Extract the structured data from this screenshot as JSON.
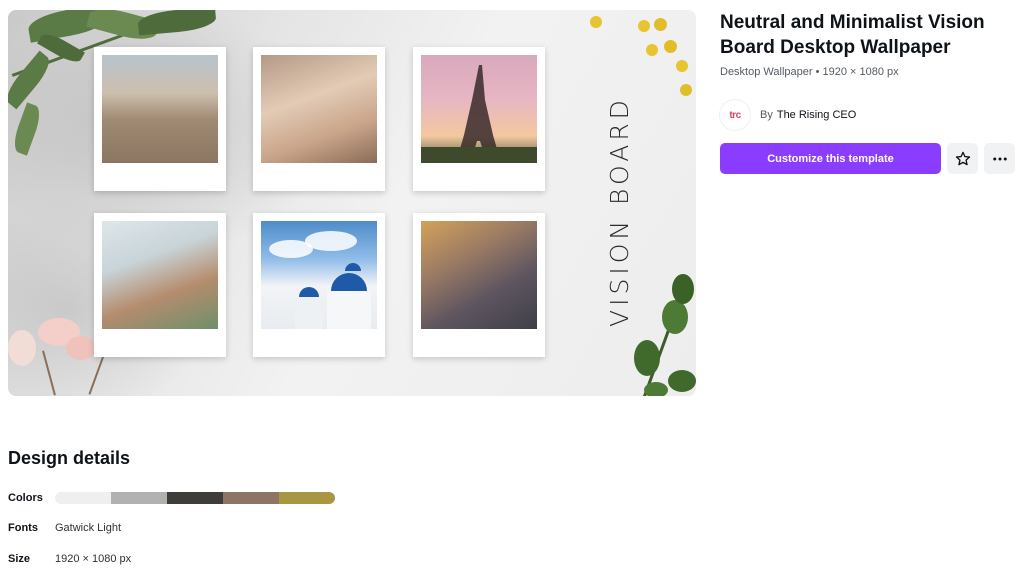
{
  "preview": {
    "vision_text": "VISION BOARD",
    "photos": [
      {
        "id": "fountain",
        "subject": "fountain-photo"
      },
      {
        "id": "family",
        "subject": "family-photo"
      },
      {
        "id": "paris",
        "subject": "eiffel-tower-photo"
      },
      {
        "id": "kitchen",
        "subject": "kitchen-photo"
      },
      {
        "id": "santorini",
        "subject": "santorini-photo"
      },
      {
        "id": "couple",
        "subject": "couple-photo"
      }
    ]
  },
  "template": {
    "title": "Neutral and Minimalist Vision Board Desktop Wallpaper",
    "subtitle": "Desktop Wallpaper • 1920 × 1080 px",
    "author_logo_text": "trc",
    "author_by": "By",
    "author_name": "The Rising CEO"
  },
  "actions": {
    "customize_label": "Customize this template",
    "favorite_icon": "star-icon",
    "more_icon": "more-horizontal-icon"
  },
  "design_details": {
    "heading": "Design details",
    "colors_label": "Colors",
    "colors": [
      "#efefef",
      "#b1b1b1",
      "#3f3d3a",
      "#8d7464",
      "#a89643"
    ],
    "fonts_label": "Fonts",
    "fonts_value": "Gatwick Light",
    "size_label": "Size",
    "size_value": "1920 × 1080 px"
  }
}
